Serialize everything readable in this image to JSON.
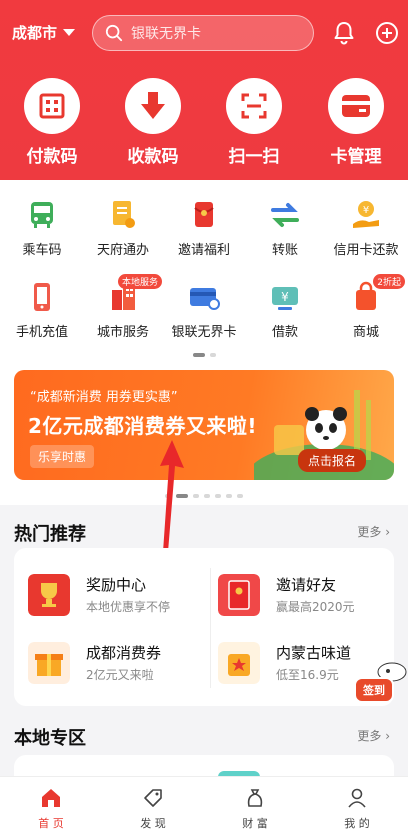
{
  "header": {
    "city": "成都市",
    "search_placeholder": "银联无界卡"
  },
  "quick_actions": [
    {
      "label": "付款码",
      "icon": "qr-code-icon"
    },
    {
      "label": "收款码",
      "icon": "download-arrow-icon"
    },
    {
      "label": "扫一扫",
      "icon": "scan-icon"
    },
    {
      "label": "卡管理",
      "icon": "card-icon"
    }
  ],
  "services": [
    {
      "label": "乘车码",
      "icon": "bus-icon"
    },
    {
      "label": "天府通办",
      "icon": "document-icon"
    },
    {
      "label": "邀请福利",
      "icon": "red-envelope-icon"
    },
    {
      "label": "转账",
      "icon": "transfer-icon"
    },
    {
      "label": "信用卡还款",
      "icon": "credit-repay-icon"
    },
    {
      "label": "手机充值",
      "icon": "phone-icon"
    },
    {
      "label": "城市服务",
      "icon": "city-icon",
      "tag": "本地服务"
    },
    {
      "label": "银联无界卡",
      "icon": "unionpay-card-icon"
    },
    {
      "label": "借款",
      "icon": "loan-icon"
    },
    {
      "label": "商城",
      "icon": "shopping-bag-icon",
      "tag": "2折起"
    }
  ],
  "banner": {
    "line1": "“成都新消费 用券更实惠”",
    "line2": "2亿元成都消费券又来啦!",
    "button": "乐享时惠",
    "cta": "点击报名"
  },
  "hot": {
    "title": "热门推荐",
    "more": "更多",
    "items": [
      {
        "title": "奖励中心",
        "sub": "本地优惠享不停",
        "icon": "trophy-icon"
      },
      {
        "title": "邀请好友",
        "sub": "赢最高2020元",
        "icon": "invite-envelope-icon"
      },
      {
        "title": "成都消费券",
        "sub": "2亿元又来啦",
        "icon": "gift-box-icon"
      },
      {
        "title": "内蒙古味道",
        "sub": "低至16.9元",
        "icon": "star-bag-icon"
      }
    ]
  },
  "signin": "签到",
  "local": {
    "title": "本地专区",
    "more": "更多"
  },
  "tabs": [
    {
      "label": "首 页",
      "icon": "home-icon",
      "active": true
    },
    {
      "label": "发 现",
      "icon": "tag-icon"
    },
    {
      "label": "财 富",
      "icon": "money-bag-icon"
    },
    {
      "label": "我 的",
      "icon": "person-icon"
    }
  ],
  "colors": {
    "brand_red": "#ef3a40",
    "orange": "#ff6a1f"
  }
}
